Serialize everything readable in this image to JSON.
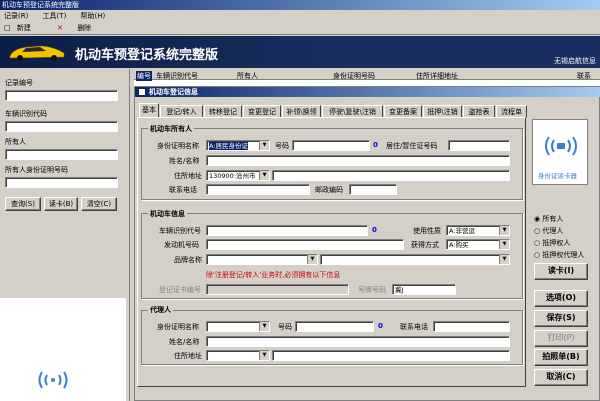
{
  "window": {
    "title": "机动车预登记系统完整版"
  },
  "menu": {
    "record": "记录(R)",
    "tools": "工具(T)",
    "help": "帮助(H)"
  },
  "toolbar": {
    "new": "新建",
    "delete": "删除"
  },
  "banner": {
    "title": "机动车预登记系统完整版",
    "company": "无锡启航信息"
  },
  "search": {
    "record_no": "记录编号",
    "vin": "车辆识别代码",
    "owner": "所有人",
    "owner_id": "所有人身份证明号码",
    "query": "查询(S)",
    "read_card": "读卡(B)",
    "clear": "清空(C)"
  },
  "table": {
    "columns": [
      "编号",
      "车辆识别代号",
      "所有人",
      "身份证明号码",
      "住所详细地址",
      "联系"
    ]
  },
  "dialog": {
    "title": "机动车登记信息",
    "tabs": [
      "基本",
      "登记/转入",
      "转移登记",
      "变更登记",
      "补领\\换领",
      "停驶\\复驶\\注销",
      "变更备案",
      "抵押\\注销",
      "盗抢表",
      "流程单"
    ],
    "owner_group": {
      "title": "机动车所有人",
      "id_type_label": "身份证明名称",
      "id_type_value": "A:居民身份证",
      "id_no_label": "号码",
      "id_no_count": "0",
      "residence_label": "居住/暂住证号码",
      "name_label": "姓名/名称",
      "address_label": "住所地址",
      "address_value": "130900:沧州市",
      "phone_label": "联系电话",
      "postcode_label": "邮政编码"
    },
    "vehicle_group": {
      "title": "机动车信息",
      "vin_label": "车辆识别代号",
      "vin_count": "0",
      "use_label": "使用性质",
      "use_value": "A:非营运",
      "engine_label": "发动机号码",
      "acquire_label": "获得方式",
      "acquire_value": "A:购买",
      "brand_label": "品牌名称",
      "warning": "除'注册登记/转入'业务时,必须拥有以下信息",
      "cert_label": "登记证书编号",
      "plate_label": "号牌号码",
      "plate_value": "冀J"
    },
    "agent_group": {
      "title": "代理人",
      "id_type_label": "身份证明名称",
      "id_no_label": "号码",
      "id_no_count": "0",
      "phone_label": "联系电话",
      "name_label": "姓名/名称",
      "address_label": "住所地址"
    },
    "reader": {
      "label": "身份证读卡器"
    },
    "radios": [
      "所有人",
      "代理人",
      "抵押权人",
      "抵押权代理人"
    ],
    "buttons": {
      "read": "读卡(I)",
      "options": "选项(O)",
      "save": "保存(S)",
      "print": "打印(P)",
      "photo": "拍照单(B)",
      "cancel": "取消(C)"
    }
  }
}
